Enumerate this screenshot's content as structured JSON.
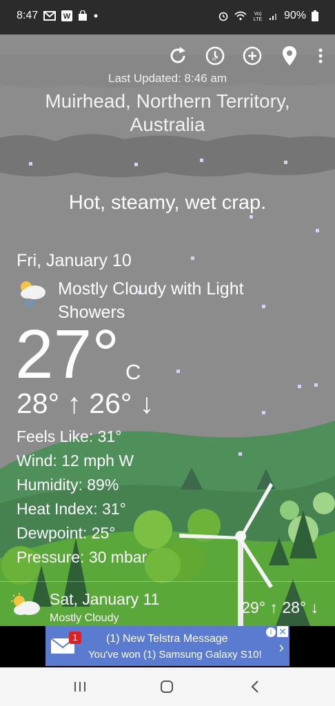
{
  "status_bar": {
    "time": "8:47",
    "battery": "90%",
    "left_icons": [
      "gmail-icon",
      "w-app-icon",
      "shopping-bag-icon",
      "dot-icon"
    ],
    "right_icons": [
      "alarm-icon",
      "wifi-icon",
      "volte-icon",
      "signal-icon",
      "battery-icon"
    ]
  },
  "toolbar": {
    "icons": [
      "refresh-icon",
      "history-clock-icon",
      "add-location-icon",
      "location-pin-icon",
      "overflow-menu-icon"
    ]
  },
  "header": {
    "last_updated": "Last Updated: 8:46 am",
    "location": "Muirhead, Northern Territory, Australia"
  },
  "tagline": "Hot, steamy, wet crap.",
  "current": {
    "date": "Fri, January 10",
    "condition": "Mostly Cloudy with Light Showers",
    "temperature": "27°",
    "unit": "C",
    "high_low": "28° ↑ 26° ↓",
    "details": [
      "Feels Like: 31°",
      "Wind: 12 mph W",
      "Humidity: 89%",
      "Heat Index: 31°",
      "Dewpoint: 25°",
      "Pressure: 30 mbar"
    ]
  },
  "forecast": {
    "date": "Sat, January 11",
    "condition": "Mostly Cloudy",
    "high_low": "29° ↑ 28° ↓"
  },
  "ad": {
    "badge": "1",
    "line1": "(1) New Telstra Message",
    "line2": "You've won (1) Samsung Galaxy S10!",
    "chevron": "›",
    "info": "i",
    "close": "✕"
  },
  "navbar": {
    "recents": "III",
    "home": "○",
    "back": "‹"
  },
  "colors": {
    "sky": "#8c8c8c",
    "grass": "#5aa83a",
    "hills": "#4f8f5a",
    "ad_blue": "#5b7bd0"
  }
}
